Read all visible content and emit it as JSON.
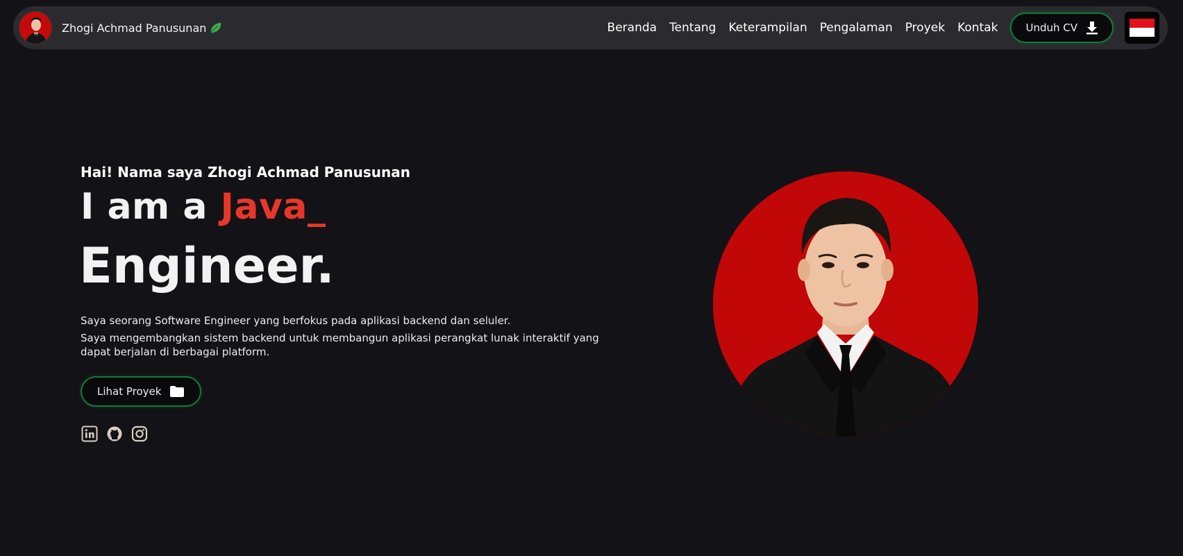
{
  "brand": {
    "name": "Zhogi Achmad Panusunan"
  },
  "nav": {
    "links": [
      "Beranda",
      "Tentang",
      "Keterampilan",
      "Pengalaman",
      "Proyek",
      "Kontak"
    ],
    "cv_button": "Unduh CV"
  },
  "hero": {
    "greeting": "Hai! Nama saya Zhogi Achmad Panusunan",
    "headline_prefix": "I am a ",
    "headline_accent": "Java_",
    "role": "Engineer.",
    "desc_line1": "Saya seorang Software Engineer yang berfokus pada aplikasi backend dan seluler.",
    "desc_line2": "Saya mengembangkan sistem backend untuk membangun aplikasi perangkat lunak interaktif yang dapat berjalan di berbagai platform.",
    "projects_button": "Lihat Proyek"
  },
  "icons": {
    "leaf": "leaf-icon",
    "download": "download-icon",
    "flag": "indonesia-flag-icon",
    "folder": "folder-icon",
    "socials": [
      "linkedin-icon",
      "github-icon",
      "instagram-icon"
    ]
  },
  "colors": {
    "background": "#131217",
    "navbar": "#2b2b2f",
    "accent": "#e8372a",
    "button_border": "#127a3a",
    "portrait_bg": "#c10707"
  }
}
